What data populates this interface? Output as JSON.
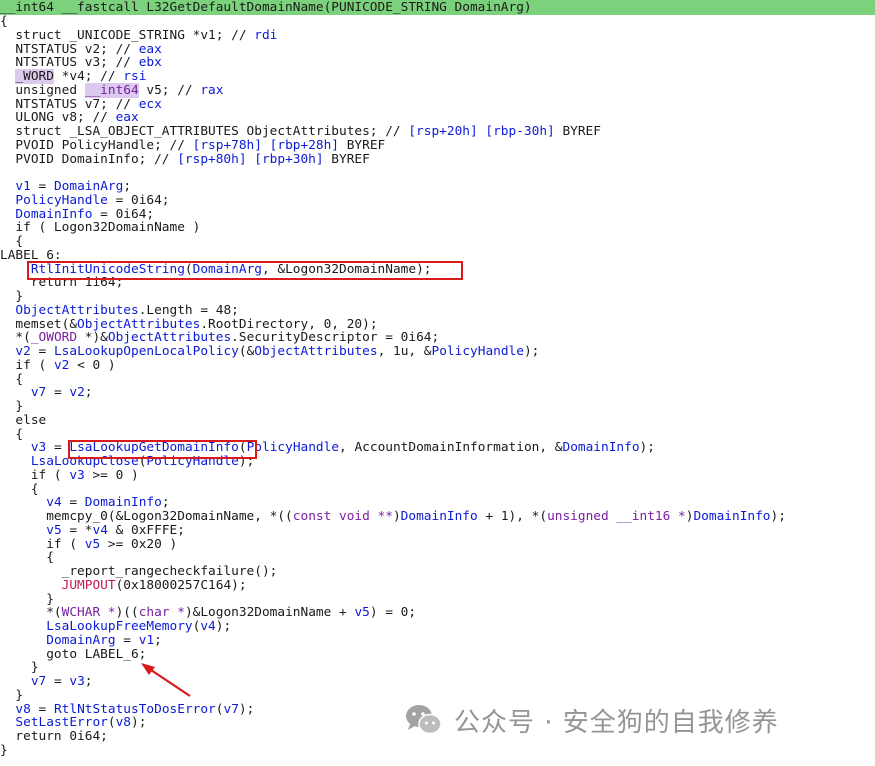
{
  "editor": {
    "lines": [
      {
        "cls": "header",
        "tokens": [
          {
            "t": "__int64 __fastcall L32GetDefaultDomainName(PUNICODE_STRING DomainArg)",
            "c": "plain"
          }
        ]
      },
      {
        "tokens": [
          {
            "t": "{",
            "c": "plain"
          }
        ]
      },
      {
        "tokens": [
          {
            "t": "  struct _UNICODE_STRING *v1; // rdi",
            "c": "comment-mixed",
            "parts": [
              {
                "t": "  struct _UNICODE_STRING *v1; // ",
                "c": "plain"
              },
              {
                "t": "rdi",
                "c": "comment-reg"
              }
            ]
          }
        ]
      },
      {
        "tokens": [
          {
            "t": "  NTSTATUS v2; // ",
            "c": "plain"
          },
          {
            "t": "eax",
            "c": "comment-reg"
          }
        ]
      },
      {
        "tokens": [
          {
            "t": "  NTSTATUS v3; // ",
            "c": "plain"
          },
          {
            "t": "ebx",
            "c": "comment-reg"
          }
        ]
      },
      {
        "tokens": [
          {
            "t": "  ",
            "c": "plain"
          },
          {
            "t": "_WORD",
            "c": "hl"
          },
          {
            "t": " *v4; // ",
            "c": "plain"
          },
          {
            "t": "rsi",
            "c": "comment-reg"
          }
        ]
      },
      {
        "tokens": [
          {
            "t": "  unsigned ",
            "c": "plain"
          },
          {
            "t": "__int64",
            "c": "hlpurple"
          },
          {
            "t": " v5; // ",
            "c": "plain"
          },
          {
            "t": "rax",
            "c": "comment-reg"
          }
        ]
      },
      {
        "tokens": [
          {
            "t": "  NTSTATUS v7; // ",
            "c": "plain"
          },
          {
            "t": "ecx",
            "c": "comment-reg"
          }
        ]
      },
      {
        "tokens": [
          {
            "t": "  ULONG v8; // ",
            "c": "plain"
          },
          {
            "t": "eax",
            "c": "comment-reg"
          }
        ]
      },
      {
        "tokens": [
          {
            "t": "  struct _LSA_OBJECT_ATTRIBUTES ObjectAttributes; // ",
            "c": "plain"
          },
          {
            "t": "[rsp+20h] [rbp-30h]",
            "c": "comment-reg"
          },
          {
            "t": " BYREF",
            "c": "plain"
          }
        ]
      },
      {
        "tokens": [
          {
            "t": "  PVOID PolicyHandle; // ",
            "c": "plain"
          },
          {
            "t": "[rsp+78h] [rbp+28h]",
            "c": "comment-reg"
          },
          {
            "t": " BYREF",
            "c": "plain"
          }
        ]
      },
      {
        "tokens": [
          {
            "t": "  PVOID DomainInfo; // ",
            "c": "plain"
          },
          {
            "t": "[rsp+80h] [rbp+30h]",
            "c": "comment-reg"
          },
          {
            "t": " BYREF",
            "c": "plain"
          }
        ]
      },
      {
        "tokens": [
          {
            "t": "",
            "c": "plain"
          }
        ]
      },
      {
        "tokens": [
          {
            "t": "  ",
            "c": "plain"
          },
          {
            "t": "v1",
            "c": "ident"
          },
          {
            "t": " = ",
            "c": "plain"
          },
          {
            "t": "DomainArg",
            "c": "ident"
          },
          {
            "t": ";",
            "c": "plain"
          }
        ]
      },
      {
        "tokens": [
          {
            "t": "  ",
            "c": "plain"
          },
          {
            "t": "PolicyHandle",
            "c": "ident"
          },
          {
            "t": " = 0i64;",
            "c": "plain"
          }
        ]
      },
      {
        "tokens": [
          {
            "t": "  ",
            "c": "plain"
          },
          {
            "t": "DomainInfo",
            "c": "ident"
          },
          {
            "t": " = 0i64;",
            "c": "plain"
          }
        ]
      },
      {
        "tokens": [
          {
            "t": "  if ( Logon32DomainName )",
            "c": "plain"
          }
        ]
      },
      {
        "tokens": [
          {
            "t": "  {",
            "c": "plain"
          }
        ]
      },
      {
        "tokens": [
          {
            "t": "LABEL_6:",
            "c": "plain"
          }
        ]
      },
      {
        "tokens": [
          {
            "t": "    ",
            "c": "plain"
          },
          {
            "t": "RtlInitUnicodeString",
            "c": "func"
          },
          {
            "t": "(",
            "c": "plain"
          },
          {
            "t": "DomainArg",
            "c": "ident"
          },
          {
            "t": ", &Logon32DomainName);",
            "c": "plain"
          }
        ]
      },
      {
        "tokens": [
          {
            "t": "    return 1i64;",
            "c": "plain"
          }
        ]
      },
      {
        "tokens": [
          {
            "t": "  }",
            "c": "plain"
          }
        ]
      },
      {
        "tokens": [
          {
            "t": "  ",
            "c": "plain"
          },
          {
            "t": "ObjectAttributes",
            "c": "ident"
          },
          {
            "t": ".Length = 48;",
            "c": "plain"
          }
        ]
      },
      {
        "tokens": [
          {
            "t": "  memset(&",
            "c": "plain"
          },
          {
            "t": "ObjectAttributes",
            "c": "ident"
          },
          {
            "t": ".RootDirectory, 0, 20);",
            "c": "plain"
          }
        ]
      },
      {
        "tokens": [
          {
            "t": "  *(",
            "c": "plain"
          },
          {
            "t": "_OWORD",
            "c": "purple"
          },
          {
            "t": " *)&",
            "c": "plain"
          },
          {
            "t": "ObjectAttributes",
            "c": "ident"
          },
          {
            "t": ".SecurityDescriptor = 0i64;",
            "c": "plain"
          }
        ]
      },
      {
        "tokens": [
          {
            "t": "  ",
            "c": "plain"
          },
          {
            "t": "v2",
            "c": "ident"
          },
          {
            "t": " = ",
            "c": "plain"
          },
          {
            "t": "LsaLookupOpenLocalPolicy",
            "c": "func"
          },
          {
            "t": "(&",
            "c": "plain"
          },
          {
            "t": "ObjectAttributes",
            "c": "ident"
          },
          {
            "t": ", 1u, &",
            "c": "plain"
          },
          {
            "t": "PolicyHandle",
            "c": "ident"
          },
          {
            "t": ");",
            "c": "plain"
          }
        ]
      },
      {
        "tokens": [
          {
            "t": "  if ( ",
            "c": "plain"
          },
          {
            "t": "v2",
            "c": "ident"
          },
          {
            "t": " < 0 )",
            "c": "plain"
          }
        ]
      },
      {
        "tokens": [
          {
            "t": "  {",
            "c": "plain"
          }
        ]
      },
      {
        "tokens": [
          {
            "t": "    ",
            "c": "plain"
          },
          {
            "t": "v7",
            "c": "ident"
          },
          {
            "t": " = ",
            "c": "plain"
          },
          {
            "t": "v2",
            "c": "ident"
          },
          {
            "t": ";",
            "c": "plain"
          }
        ]
      },
      {
        "tokens": [
          {
            "t": "  }",
            "c": "plain"
          }
        ]
      },
      {
        "tokens": [
          {
            "t": "  else",
            "c": "plain"
          }
        ]
      },
      {
        "tokens": [
          {
            "t": "  {",
            "c": "plain"
          }
        ]
      },
      {
        "tokens": [
          {
            "t": "    ",
            "c": "plain"
          },
          {
            "t": "v3",
            "c": "ident"
          },
          {
            "t": " = ",
            "c": "plain"
          },
          {
            "t": "LsaLookupGetDomainInfo",
            "c": "func"
          },
          {
            "t": "(",
            "c": "plain"
          },
          {
            "t": "PolicyHandle",
            "c": "ident"
          },
          {
            "t": ", AccountDomainInformation, &",
            "c": "plain"
          },
          {
            "t": "DomainInfo",
            "c": "ident"
          },
          {
            "t": ");",
            "c": "plain"
          }
        ]
      },
      {
        "tokens": [
          {
            "t": "    ",
            "c": "plain"
          },
          {
            "t": "LsaLookupClose",
            "c": "func"
          },
          {
            "t": "(",
            "c": "plain"
          },
          {
            "t": "PolicyHandle",
            "c": "ident"
          },
          {
            "t": ");",
            "c": "plain"
          }
        ]
      },
      {
        "tokens": [
          {
            "t": "    if ( ",
            "c": "plain"
          },
          {
            "t": "v3",
            "c": "ident"
          },
          {
            "t": " >= 0 )",
            "c": "plain"
          }
        ]
      },
      {
        "tokens": [
          {
            "t": "    {",
            "c": "plain"
          }
        ]
      },
      {
        "tokens": [
          {
            "t": "      ",
            "c": "plain"
          },
          {
            "t": "v4",
            "c": "ident"
          },
          {
            "t": " = ",
            "c": "plain"
          },
          {
            "t": "DomainInfo",
            "c": "ident"
          },
          {
            "t": ";",
            "c": "plain"
          }
        ]
      },
      {
        "tokens": [
          {
            "t": "      memcpy_0(&Logon32DomainName, *((",
            "c": "plain"
          },
          {
            "t": "const void **",
            "c": "purple"
          },
          {
            "t": ")",
            "c": "plain"
          },
          {
            "t": "DomainInfo",
            "c": "ident"
          },
          {
            "t": " + 1), *(",
            "c": "plain"
          },
          {
            "t": "unsigned __int16 *",
            "c": "purple"
          },
          {
            "t": ")",
            "c": "plain"
          },
          {
            "t": "DomainInfo",
            "c": "ident"
          },
          {
            "t": ");",
            "c": "plain"
          }
        ]
      },
      {
        "tokens": [
          {
            "t": "      ",
            "c": "plain"
          },
          {
            "t": "v5",
            "c": "ident"
          },
          {
            "t": " = *",
            "c": "plain"
          },
          {
            "t": "v4",
            "c": "ident"
          },
          {
            "t": " & 0xFFFE;",
            "c": "plain"
          }
        ]
      },
      {
        "tokens": [
          {
            "t": "      if ( ",
            "c": "plain"
          },
          {
            "t": "v5",
            "c": "ident"
          },
          {
            "t": " >= 0x20 )",
            "c": "plain"
          }
        ]
      },
      {
        "tokens": [
          {
            "t": "      {",
            "c": "plain"
          }
        ]
      },
      {
        "tokens": [
          {
            "t": "        _report_rangecheckfailure();",
            "c": "plain"
          }
        ]
      },
      {
        "tokens": [
          {
            "t": "        ",
            "c": "plain"
          },
          {
            "t": "JUMPOUT",
            "c": "jump"
          },
          {
            "t": "(0x18000257C164);",
            "c": "plain"
          }
        ]
      },
      {
        "tokens": [
          {
            "t": "      }",
            "c": "plain"
          }
        ]
      },
      {
        "tokens": [
          {
            "t": "      *(",
            "c": "plain"
          },
          {
            "t": "WCHAR *",
            "c": "purple"
          },
          {
            "t": ")((",
            "c": "plain"
          },
          {
            "t": "char *",
            "c": "purple"
          },
          {
            "t": ")&Logon32DomainName + ",
            "c": "plain"
          },
          {
            "t": "v5",
            "c": "ident"
          },
          {
            "t": ") = 0;",
            "c": "plain"
          }
        ]
      },
      {
        "tokens": [
          {
            "t": "      ",
            "c": "plain"
          },
          {
            "t": "LsaLookupFreeMemory",
            "c": "func"
          },
          {
            "t": "(",
            "c": "plain"
          },
          {
            "t": "v4",
            "c": "ident"
          },
          {
            "t": ");",
            "c": "plain"
          }
        ]
      },
      {
        "tokens": [
          {
            "t": "      ",
            "c": "plain"
          },
          {
            "t": "DomainArg",
            "c": "ident"
          },
          {
            "t": " = ",
            "c": "plain"
          },
          {
            "t": "v1",
            "c": "ident"
          },
          {
            "t": ";",
            "c": "plain"
          }
        ]
      },
      {
        "tokens": [
          {
            "t": "      goto LABEL_6;",
            "c": "plain"
          }
        ]
      },
      {
        "tokens": [
          {
            "t": "    }",
            "c": "plain"
          }
        ]
      },
      {
        "tokens": [
          {
            "t": "    ",
            "c": "plain"
          },
          {
            "t": "v7",
            "c": "ident"
          },
          {
            "t": " = ",
            "c": "plain"
          },
          {
            "t": "v3",
            "c": "ident"
          },
          {
            "t": ";",
            "c": "plain"
          }
        ]
      },
      {
        "tokens": [
          {
            "t": "  }",
            "c": "plain"
          }
        ]
      },
      {
        "tokens": [
          {
            "t": "  ",
            "c": "plain"
          },
          {
            "t": "v8",
            "c": "ident"
          },
          {
            "t": " = ",
            "c": "plain"
          },
          {
            "t": "RtlNtStatusToDosError",
            "c": "func"
          },
          {
            "t": "(",
            "c": "plain"
          },
          {
            "t": "v7",
            "c": "ident"
          },
          {
            "t": ");",
            "c": "plain"
          }
        ]
      },
      {
        "tokens": [
          {
            "t": "  ",
            "c": "plain"
          },
          {
            "t": "SetLastError",
            "c": "func"
          },
          {
            "t": "(",
            "c": "plain"
          },
          {
            "t": "v8",
            "c": "ident"
          },
          {
            "t": ");",
            "c": "plain"
          }
        ]
      },
      {
        "tokens": [
          {
            "t": "  return 0i64;",
            "c": "plain"
          }
        ]
      },
      {
        "tokens": [
          {
            "t": "}",
            "c": "plain"
          }
        ]
      }
    ]
  },
  "annotations": {
    "red_box_color": "#d91a1a",
    "arrow_color": "#d91a1a"
  },
  "watermark": {
    "text": "公众号 · 安全狗的自我修养",
    "icon": "wechat-icon"
  },
  "colors": {
    "header_bg": "#7cd27c",
    "identifier": "#0b1bd6",
    "type_purple": "#7a1fa2",
    "jumpout": "#c2185b"
  }
}
